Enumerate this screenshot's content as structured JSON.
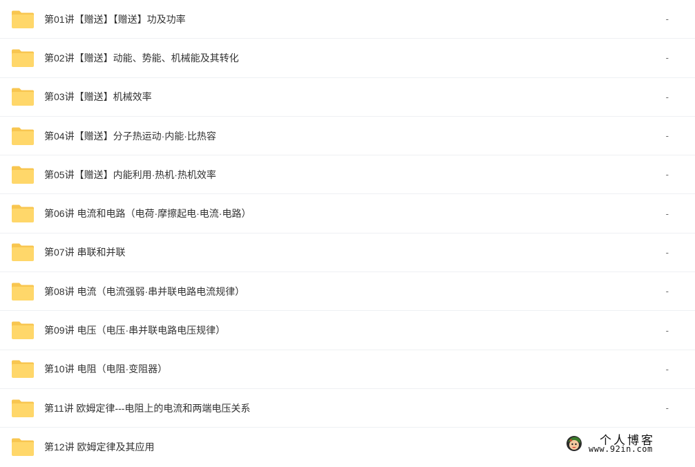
{
  "colors": {
    "folder_body": "#ffd76a",
    "folder_tab": "#f8c650",
    "row_divider": "#eef0f3",
    "text": "#333333",
    "muted": "#666666"
  },
  "rows": [
    {
      "name": "第01讲【赠送】【赠送】功及功率",
      "size": "-",
      "icon": "folder-icon"
    },
    {
      "name": "第02讲【赠送】动能、势能、机械能及其转化",
      "size": "-",
      "icon": "folder-icon"
    },
    {
      "name": "第03讲【赠送】机械效率",
      "size": "-",
      "icon": "folder-icon"
    },
    {
      "name": "第04讲【赠送】分子热运动·内能·比热容",
      "size": "-",
      "icon": "folder-icon"
    },
    {
      "name": "第05讲【赠送】内能利用·热机·热机效率",
      "size": "-",
      "icon": "folder-icon"
    },
    {
      "name": "第06讲 电流和电路（电荷·摩擦起电·电流·电路）",
      "size": "-",
      "icon": "folder-icon"
    },
    {
      "name": "第07讲 串联和并联",
      "size": "-",
      "icon": "folder-icon"
    },
    {
      "name": "第08讲 电流（电流强弱·串并联电路电流规律）",
      "size": "-",
      "icon": "folder-icon"
    },
    {
      "name": "第09讲 电压（电压·串并联电路电压规律）",
      "size": "-",
      "icon": "folder-icon"
    },
    {
      "name": "第10讲 电阻（电阻·变阻器）",
      "size": "-",
      "icon": "folder-icon"
    },
    {
      "name": "第11讲 欧姆定律---电阻上的电流和两端电压关系",
      "size": "-",
      "icon": "folder-icon"
    },
    {
      "name": "第12讲 欧姆定律及其应用",
      "size": "",
      "icon": "folder-icon"
    }
  ],
  "watermark": {
    "title": "个人博客",
    "url": "www.92in.com",
    "icon": "avatar-icon"
  }
}
